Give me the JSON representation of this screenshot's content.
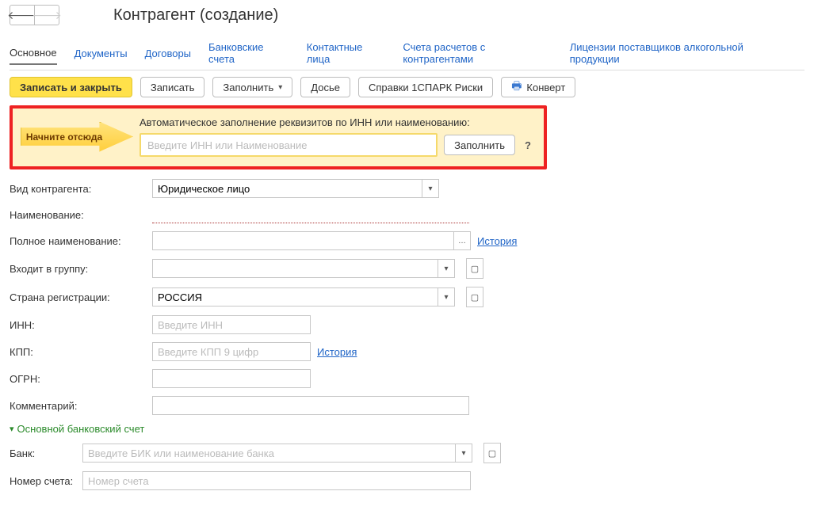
{
  "header": {
    "title": "Контрагент (создание)"
  },
  "tabs": {
    "main": "Основное",
    "documents": "Документы",
    "contracts": "Договоры",
    "bank_accounts": "Банковские счета",
    "contacts": "Контактные лица",
    "settlement_accounts": "Счета расчетов с контрагентами",
    "alcohol_licenses": "Лицензии поставщиков алкогольной продукции"
  },
  "toolbar": {
    "save_close": "Записать и закрыть",
    "save": "Записать",
    "fill": "Заполнить",
    "dossier": "Досье",
    "spark": "Справки 1СПАРК Риски",
    "envelope": "Конверт"
  },
  "callout": {
    "start_here": "Начните отсюда",
    "hint_label": "Автоматическое заполнение реквизитов по ИНН или наименованию:",
    "placeholder": "Введите ИНН или Наименование",
    "fill_btn": "Заполнить",
    "help": "?"
  },
  "form": {
    "type_label": "Вид контрагента:",
    "type_value": "Юридическое лицо",
    "name_label": "Наименование:",
    "name_value": "",
    "full_name_label": "Полное наименование:",
    "full_name_value": "",
    "history_link": "История",
    "group_label": "Входит в группу:",
    "group_value": "",
    "country_label": "Страна регистрации:",
    "country_value": "РОССИЯ",
    "inn_label": "ИНН:",
    "inn_placeholder": "Введите ИНН",
    "kpp_label": "КПП:",
    "kpp_placeholder": "Введите КПП 9 цифр",
    "ogrn_label": "ОГРН:",
    "ogrn_value": "",
    "comment_label": "Комментарий:",
    "comment_value": ""
  },
  "bank_section": {
    "title": "Основной банковский счет",
    "bank_label": "Банк:",
    "bank_placeholder": "Введите БИК или наименование банка",
    "account_label": "Номер счета:",
    "account_placeholder": "Номер счета"
  }
}
